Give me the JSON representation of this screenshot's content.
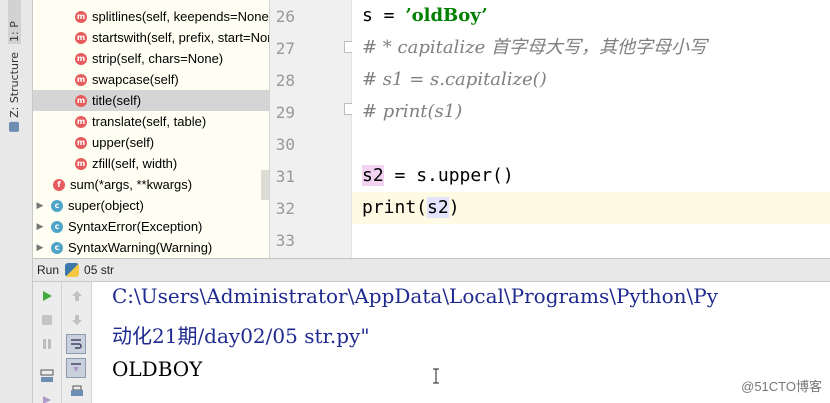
{
  "tool_stripe": {
    "project_tab": "1: P",
    "structure_tab": "Z: Structure"
  },
  "structure": {
    "items": [
      {
        "badge": "m",
        "label": "splitlines(self, keepends=None)",
        "indent": 2,
        "selected": false
      },
      {
        "badge": "m",
        "label": "startswith(self, prefix, start=None, end=None)",
        "indent": 2,
        "selected": false
      },
      {
        "badge": "m",
        "label": "strip(self, chars=None)",
        "indent": 2,
        "selected": false
      },
      {
        "badge": "m",
        "label": "swapcase(self)",
        "indent": 2,
        "selected": false
      },
      {
        "badge": "m",
        "label": "title(self)",
        "indent": 2,
        "selected": true
      },
      {
        "badge": "m",
        "label": "translate(self, table)",
        "indent": 2,
        "selected": false
      },
      {
        "badge": "m",
        "label": "upper(self)",
        "indent": 2,
        "selected": false
      },
      {
        "badge": "m",
        "label": "zfill(self, width)",
        "indent": 2,
        "selected": false
      },
      {
        "badge": "f",
        "label": "sum(*args, **kwargs)",
        "indent": 1,
        "selected": false
      },
      {
        "badge": "c",
        "label": "super(object)",
        "indent": 0,
        "selected": false,
        "expandable": true
      },
      {
        "badge": "c",
        "label": "SyntaxError(Exception)",
        "indent": 0,
        "selected": false,
        "expandable": true
      },
      {
        "badge": "c",
        "label": "SyntaxWarning(Warning)",
        "indent": 0,
        "selected": false,
        "expandable": true
      }
    ]
  },
  "editor": {
    "line_numbers": [
      "26",
      "27",
      "28",
      "29",
      "30",
      "31",
      "32",
      "33"
    ],
    "lines": {
      "l26_var": "s = ",
      "l26_str": "’oldBoy’",
      "l27": "# * capitalize 首字母大写，其他字母小写",
      "l28": "# s1 = s.capitalize()",
      "l29": "# print(s1)",
      "l31_var": "s2",
      "l31_rest": " = s.upper()",
      "l32_fn": "print(",
      "l32_arg": "s2",
      "l32_close": ")"
    }
  },
  "run": {
    "tab_label": "Run",
    "config_name": "05 str",
    "output": {
      "path_line": "C:\\Users\\Administrator\\AppData\\Local\\Programs\\Python\\Py",
      "path_line2": " 动化21期/day02/05 str.py\"",
      "result": "OLDBOY"
    }
  },
  "watermark": "@51CTO博客"
}
